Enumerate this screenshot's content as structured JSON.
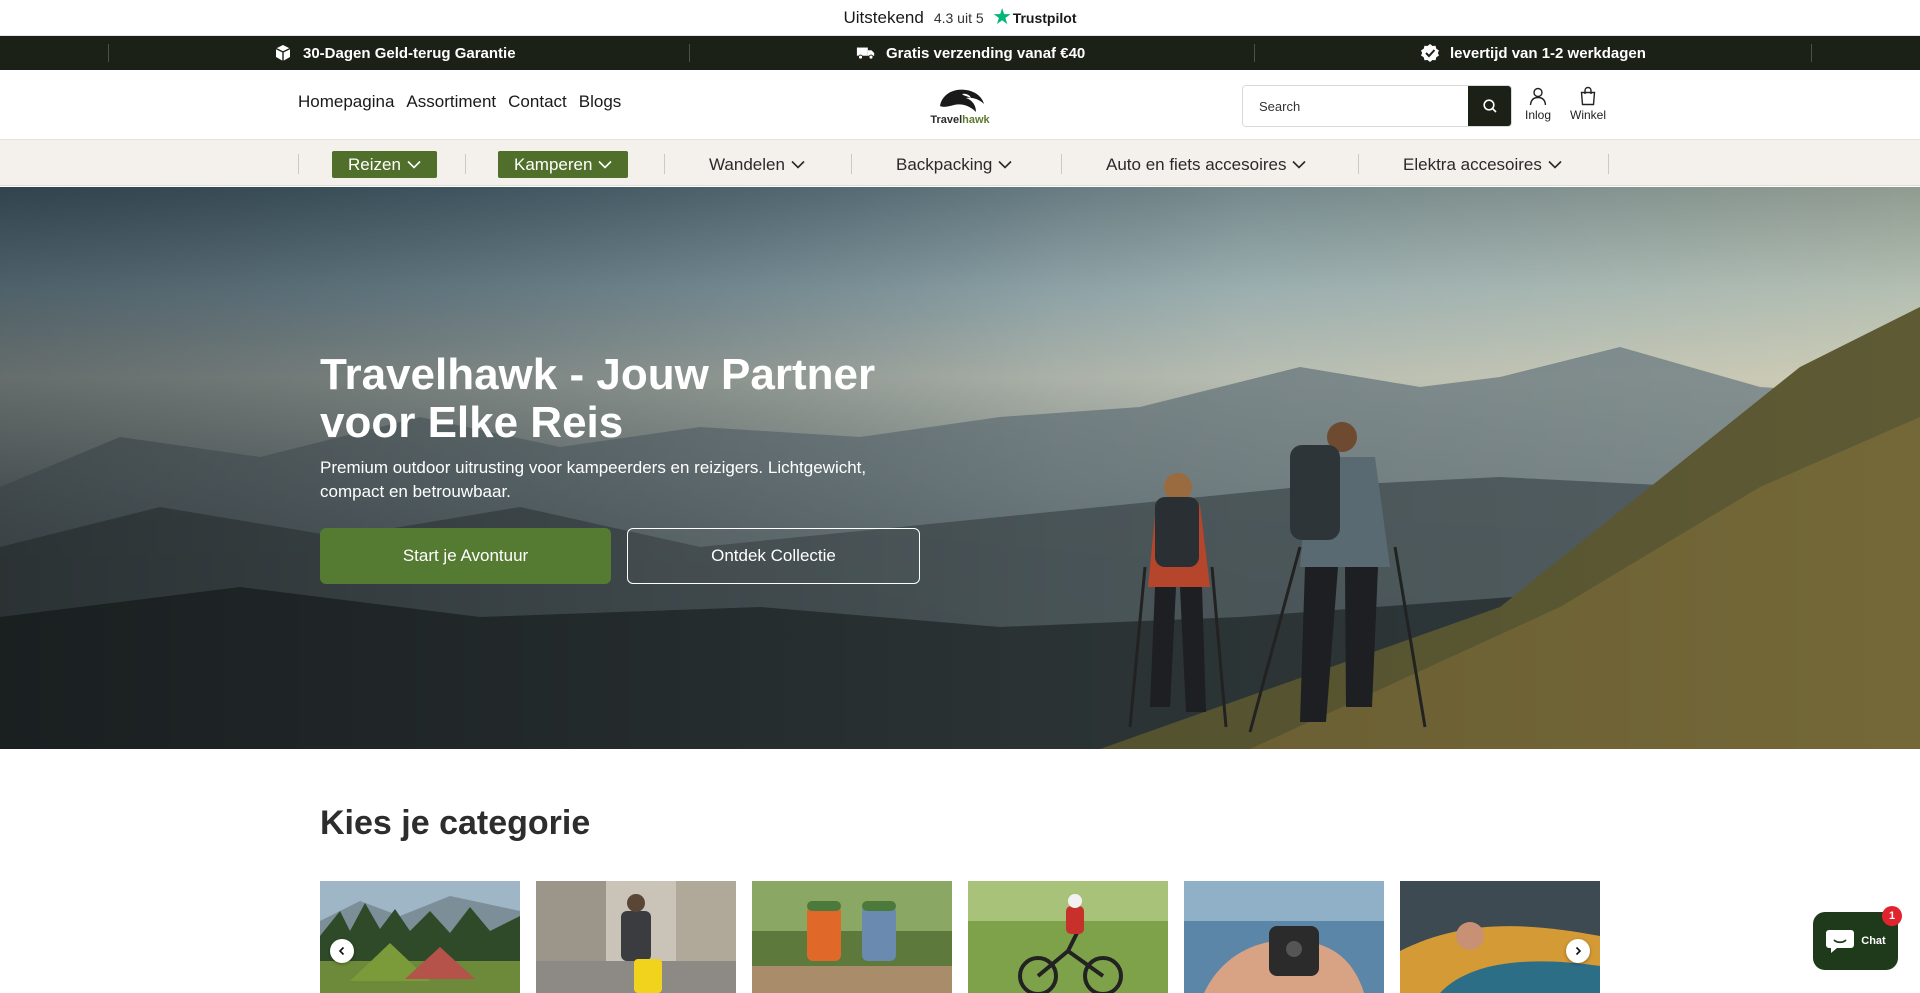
{
  "trustpilot": {
    "rating_word": "Uitstekend",
    "score": "4.3 uit 5",
    "brand": "Trustpilot"
  },
  "usp": [
    {
      "icon": "box-icon",
      "text": "30-Dagen Geld-terug Garantie"
    },
    {
      "icon": "truck-icon",
      "text": "Gratis verzending vanaf €40"
    },
    {
      "icon": "check-badge-icon",
      "text": "levertijd van 1-2 werkdagen"
    }
  ],
  "header": {
    "nav": [
      "Homepagina",
      "Assortiment",
      "Contact",
      "Blogs"
    ],
    "logo": {
      "text_part1": "Travel",
      "text_part2": "hawk",
      "accent_color": "#5c7a2e"
    },
    "search": {
      "placeholder": "Search"
    },
    "account_label": "Inlog",
    "cart_label": "Winkel"
  },
  "category_nav": [
    {
      "label": "Reizen",
      "active": true
    },
    {
      "label": "Kamperen",
      "active": true
    },
    {
      "label": "Wandelen",
      "active": false
    },
    {
      "label": "Backpacking",
      "active": false
    },
    {
      "label": "Auto en fiets accesoires",
      "active": false
    },
    {
      "label": "Elektra accesoires",
      "active": false
    }
  ],
  "hero": {
    "title": "Travelhawk - Jouw Partner voor Elke Reis",
    "subtitle": "Premium outdoor uitrusting voor kampeerders en reizigers. Lichtgewicht, compact en betrouwbaar.",
    "primary_button": "Start je Avontuur",
    "secondary_button": "Ontdek Collectie"
  },
  "categories_section": {
    "title": "Kies je categorie"
  },
  "chat": {
    "label": "Chat",
    "badge": "1"
  },
  "colors": {
    "brand_green": "#557a32",
    "dark": "#1c2118",
    "cat_nav_bg": "#f4f1ec"
  }
}
